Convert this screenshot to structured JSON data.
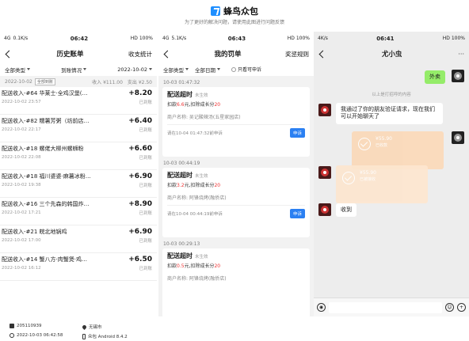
{
  "header": {
    "brand_name": "蜂鸟众包",
    "subtitle": "为了更好的解决问题，请使用此图进行问题反馈"
  },
  "phone1": {
    "status": {
      "left": "4G",
      "speed": "0.1K/s",
      "time": "06:42",
      "right": "HD 100%"
    },
    "nav": {
      "title": "历史账单",
      "action": "收支统计"
    },
    "filters": {
      "type": "全部类型",
      "status": "到账情况",
      "date": "2022-10-02"
    },
    "summary": {
      "date": "2022-10-02",
      "tag": "全部到账",
      "income": "收入 ¥111.00",
      "expense": "支出 ¥2.50"
    },
    "rows": [
      {
        "title": "配送收入-#64 华莱士·全鸡汉堡(…",
        "date": "2022-10-02 23:57",
        "amount": "+8.20",
        "status": "已到账"
      },
      {
        "title": "配送收入-#82 糯薯芳粥（坊前店…",
        "date": "2022-10-02 22:17",
        "amount": "+6.40",
        "status": "已到账"
      },
      {
        "title": "配送收入-#18 螺佬大柳州螺蛳粉",
        "date": "2022-10-02 22:08",
        "amount": "+6.60",
        "status": "已到账"
      },
      {
        "title": "配送收入-#18 福川婆婆·麻薯冰粉…",
        "date": "2022-10-02 19:38",
        "amount": "+6.90",
        "status": "已到账"
      },
      {
        "title": "配送收入-#16 三个先森的韩国炸…",
        "date": "2022-10-02 17:21",
        "amount": "+8.90",
        "status": "已到账"
      },
      {
        "title": "配送收入-#21 皖北地锅鸡",
        "date": "2022-10-02 17:00",
        "amount": "+6.90",
        "status": "已到账"
      },
      {
        "title": "配送收入-#14 蟹八方·肉蟹煲·鸡…",
        "date": "2022-10-02 16:12",
        "amount": "+6.50",
        "status": "已到账"
      }
    ]
  },
  "phone2": {
    "status": {
      "left": "4G",
      "speed": "5.1K/s",
      "time": "06:43",
      "right": "HD 100%"
    },
    "nav": {
      "title": "我的罚单",
      "action": "奖惩规则"
    },
    "filters": {
      "type": "全部类型",
      "date": "全部日期",
      "checkbox_label": "只看可申诉"
    },
    "penalties": [
      {
        "date": "10-03 01:47:32",
        "title": "配送超时",
        "status": "未生效",
        "detail_prefix": "扣款",
        "amount": "6.6",
        "detail_mid": "元,扣除成长分",
        "points": "20",
        "merchant": "商户名称: 吴记酸辣汤(五星家园店)",
        "deadline": "请在10-04 01:47:32前申诉",
        "button": "申诉"
      },
      {
        "date": "10-03 00:44:19",
        "title": "配送超时",
        "status": "未生效",
        "detail_prefix": "扣款",
        "amount": "3.2",
        "detail_mid": "元,扣除成长分",
        "points": "20",
        "merchant": "商户名称: 阿锋烧烤(融侨店)",
        "deadline": "请在10-04 00:44:19前申诉",
        "button": "申诉"
      },
      {
        "date": "10-03 00:29:13",
        "title": "配送超时",
        "status": "未生效",
        "detail_prefix": "扣款",
        "amount": "0.5",
        "detail_mid": "元,扣除成长分",
        "points": "20",
        "merchant": "商户名称: 阿锋烧烤(融侨店)",
        "deadline": "",
        "button": ""
      }
    ]
  },
  "phone3": {
    "status": {
      "left": "4K/s",
      "time": "06:41",
      "right": "HD 100%"
    },
    "nav": {
      "title": "尤小虫",
      "more": "···"
    },
    "messages": {
      "greeting": "外卖",
      "system_note": "以上是打招呼的内容",
      "friend_msg": "我通过了你的朋友验证请求，现在我们可以开始聊天了",
      "transfer1": {
        "amount": "¥55.90",
        "sub": "已收款"
      },
      "transfer2": {
        "amount": "¥55.90",
        "sub": "已被接收"
      },
      "received": "收到"
    }
  },
  "footer": {
    "id": "205110939",
    "city": "无锡市",
    "datetime": "2022-10-03 06:42:58",
    "device": "众包 Android 8.4.2"
  }
}
